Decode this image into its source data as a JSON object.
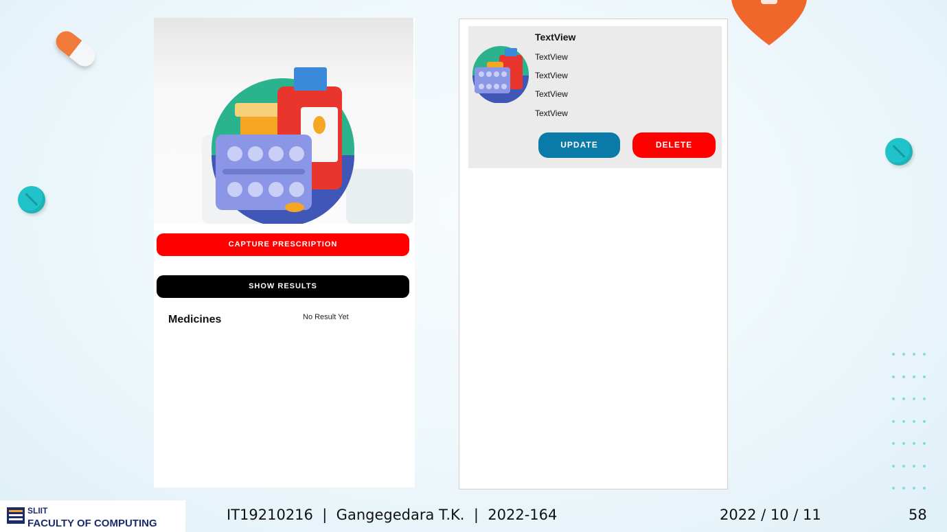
{
  "left_screen": {
    "capture_label": "CAPTURE PRESCRIPTION",
    "show_label": "SHOW RESULTS",
    "medicines_label": "Medicines",
    "result_text": "No Result Yet"
  },
  "right_screen": {
    "title": "TextView",
    "lines": [
      "TextView",
      "TextView",
      "TextView",
      "TextView"
    ],
    "update_label": "UPDATE",
    "delete_label": "DELETE"
  },
  "footer": {
    "logo_line1": "SLIIT",
    "logo_line2": "FACULTY OF COMPUTING",
    "author": "IT19210216  |  Gangegedara T.K.  |  2022-164",
    "date": "2022 / 10 / 11",
    "page_number": "58"
  },
  "colors": {
    "capture": "#ff0000",
    "show": "#000000",
    "update": "#0a7aa8",
    "delete": "#ff0000"
  }
}
